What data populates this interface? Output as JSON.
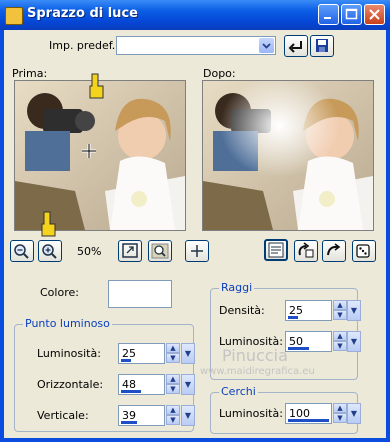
{
  "window": {
    "title": "Sprazzo di luce"
  },
  "preset": {
    "label": "Imp. predef.:",
    "value": ""
  },
  "previews": {
    "before_label": "Prima:",
    "after_label": "Dopo:"
  },
  "zoom": {
    "value": "50%"
  },
  "color": {
    "label": "Colore:",
    "value": "#ffffff"
  },
  "punto_luminoso": {
    "title": "Punto luminoso",
    "luminosita": {
      "label": "Luminosità:",
      "value": "25",
      "fraction": 0.25
    },
    "orizzontale": {
      "label": "Orizzontale:",
      "value": "48",
      "fraction": 0.48
    },
    "verticale": {
      "label": "Verticale:",
      "value": "39",
      "fraction": 0.39
    }
  },
  "raggi": {
    "title": "Raggi",
    "densita": {
      "label": "Densità:",
      "value": "25",
      "fraction": 0.25
    },
    "luminosita": {
      "label": "Luminosità:",
      "value": "50",
      "fraction": 0.5
    }
  },
  "cerchi": {
    "title": "Cerchi",
    "luminosita": {
      "label": "Luminosità:",
      "value": "100",
      "fraction": 1.0
    }
  },
  "watermark": {
    "name": "Pinuccia",
    "url": "www.maidiregrafica.eu"
  }
}
